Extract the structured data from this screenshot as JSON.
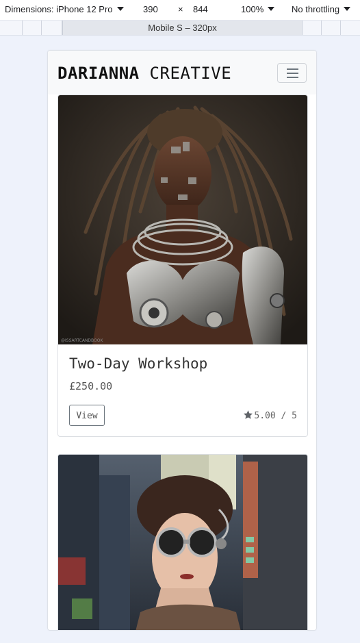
{
  "devtools": {
    "dimensions_label": "Dimensions: iPhone 12 Pro",
    "width": "390",
    "times": "×",
    "height": "844",
    "zoom": "100%",
    "throttling": "No throttling",
    "breakpoint_label": "Mobile S – 320px"
  },
  "site": {
    "brand_bold": "DARIANNA",
    "brand_light": "CREATIVE",
    "toggler_icon": "hamburger-menu-icon"
  },
  "products": [
    {
      "title": "Two-Day Workshop",
      "price": "£250.00",
      "view_label": "View",
      "rating": "5.00 / 5",
      "watermark": "@ISSARTCANDBOOK",
      "image": "portrait of a woman with long dreadlocks and silver cyborg armour"
    },
    {
      "image": "woman with dark updo wearing steampunk goggles on a city street"
    }
  ],
  "colors": {
    "page_background": "#eef2fb",
    "navbar_background": "#f8f9fa",
    "text_dark": "#333333"
  }
}
